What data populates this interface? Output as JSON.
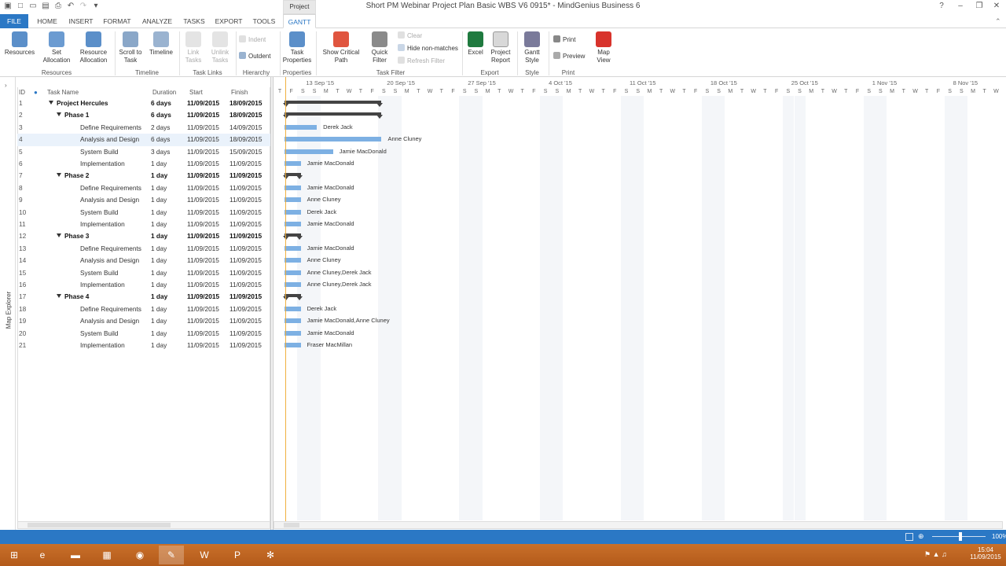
{
  "app": {
    "title": "Short PM Webinar Project Plan Basic WBS V6 0915* - MindGenius Business 6",
    "context_tab": "Project",
    "help": "?"
  },
  "tabs": [
    "FILE",
    "HOME",
    "INSERT",
    "FORMAT",
    "ANALYZE",
    "TASKS",
    "EXPORT",
    "TOOLS",
    "GANTT"
  ],
  "ribbon": {
    "resources": "Resources",
    "set_allocation": "Set Allocation",
    "resource_allocation": "Resource Allocation",
    "scroll_to_task": "Scroll to Task",
    "timeline": "Timeline",
    "link_tasks": "Link Tasks",
    "unlink_tasks": "Unlink Tasks",
    "indent": "Indent",
    "outdent": "Outdent",
    "task_properties": "Task Properties",
    "show_critical_path": "Show Critical Path",
    "quick_filter": "Quick Filter",
    "clear": "Clear",
    "hide_non_matches": "Hide non-matches",
    "refresh_filter": "Refresh Filter",
    "excel": "Excel",
    "project_report": "Project Report",
    "gantt_style": "Gantt Style",
    "print": "Print",
    "preview": "Preview",
    "map_view": "Map View",
    "groups": {
      "resources": "Resources",
      "timeline": "Timeline",
      "task_links": "Task Links",
      "hierarchy": "Hierarchy",
      "properties": "Properties",
      "task_filter": "Task Filter",
      "export": "Export",
      "style": "Style",
      "print": "Print"
    }
  },
  "map_explorer": "Map Explorer",
  "columns": {
    "id": "ID",
    "task": "Task Name",
    "duration": "Duration",
    "start": "Start",
    "finish": "Finish"
  },
  "rows": [
    {
      "id": "1",
      "name": "Project Hercules",
      "dur": "6 days",
      "start": "11/09/2015",
      "finish": "18/09/2015",
      "level": 0,
      "summary": true,
      "s": 0,
      "d": 6,
      "res": ""
    },
    {
      "id": "2",
      "name": "Phase 1",
      "dur": "6 days",
      "start": "11/09/2015",
      "finish": "18/09/2015",
      "level": 1,
      "summary": true,
      "s": 0,
      "d": 6,
      "res": ""
    },
    {
      "id": "3",
      "name": "Define Requirements",
      "dur": "2 days",
      "start": "11/09/2015",
      "finish": "14/09/2015",
      "level": 2,
      "summary": false,
      "s": 0,
      "d": 2,
      "res": "Derek Jack"
    },
    {
      "id": "4",
      "name": "Analysis and Design",
      "dur": "6 days",
      "start": "11/09/2015",
      "finish": "18/09/2015",
      "level": 2,
      "summary": false,
      "s": 0,
      "d": 6,
      "res": "Anne Cluney"
    },
    {
      "id": "5",
      "name": "System Build",
      "dur": "3 days",
      "start": "11/09/2015",
      "finish": "15/09/2015",
      "level": 2,
      "summary": false,
      "s": 0,
      "d": 3,
      "res": "Jamie MacDonald"
    },
    {
      "id": "6",
      "name": "Implementation",
      "dur": "1 day",
      "start": "11/09/2015",
      "finish": "11/09/2015",
      "level": 2,
      "summary": false,
      "s": 0,
      "d": 1,
      "res": "Jamie MacDonald"
    },
    {
      "id": "7",
      "name": "Phase 2",
      "dur": "1 day",
      "start": "11/09/2015",
      "finish": "11/09/2015",
      "level": 1,
      "summary": true,
      "s": 0,
      "d": 1,
      "res": ""
    },
    {
      "id": "8",
      "name": "Define Requirements",
      "dur": "1 day",
      "start": "11/09/2015",
      "finish": "11/09/2015",
      "level": 2,
      "summary": false,
      "s": 0,
      "d": 1,
      "res": "Jamie MacDonald"
    },
    {
      "id": "9",
      "name": "Analysis and Design",
      "dur": "1 day",
      "start": "11/09/2015",
      "finish": "11/09/2015",
      "level": 2,
      "summary": false,
      "s": 0,
      "d": 1,
      "res": "Anne Cluney"
    },
    {
      "id": "10",
      "name": "System Build",
      "dur": "1 day",
      "start": "11/09/2015",
      "finish": "11/09/2015",
      "level": 2,
      "summary": false,
      "s": 0,
      "d": 1,
      "res": "Derek Jack"
    },
    {
      "id": "11",
      "name": "Implementation",
      "dur": "1 day",
      "start": "11/09/2015",
      "finish": "11/09/2015",
      "level": 2,
      "summary": false,
      "s": 0,
      "d": 1,
      "res": "Jamie MacDonald"
    },
    {
      "id": "12",
      "name": "Phase 3",
      "dur": "1 day",
      "start": "11/09/2015",
      "finish": "11/09/2015",
      "level": 1,
      "summary": true,
      "s": 0,
      "d": 1,
      "res": ""
    },
    {
      "id": "13",
      "name": "Define Requirements",
      "dur": "1 day",
      "start": "11/09/2015",
      "finish": "11/09/2015",
      "level": 2,
      "summary": false,
      "s": 0,
      "d": 1,
      "res": "Jamie MacDonald"
    },
    {
      "id": "14",
      "name": "Analysis and Design",
      "dur": "1 day",
      "start": "11/09/2015",
      "finish": "11/09/2015",
      "level": 2,
      "summary": false,
      "s": 0,
      "d": 1,
      "res": "Anne Cluney"
    },
    {
      "id": "15",
      "name": "System Build",
      "dur": "1 day",
      "start": "11/09/2015",
      "finish": "11/09/2015",
      "level": 2,
      "summary": false,
      "s": 0,
      "d": 1,
      "res": "Anne Cluney,Derek Jack"
    },
    {
      "id": "16",
      "name": "Implementation",
      "dur": "1 day",
      "start": "11/09/2015",
      "finish": "11/09/2015",
      "level": 2,
      "summary": false,
      "s": 0,
      "d": 1,
      "res": "Anne Cluney,Derek Jack"
    },
    {
      "id": "17",
      "name": "Phase 4",
      "dur": "1 day",
      "start": "11/09/2015",
      "finish": "11/09/2015",
      "level": 1,
      "summary": true,
      "s": 0,
      "d": 1,
      "res": ""
    },
    {
      "id": "18",
      "name": "Define Requirements",
      "dur": "1 day",
      "start": "11/09/2015",
      "finish": "11/09/2015",
      "level": 2,
      "summary": false,
      "s": 0,
      "d": 1,
      "res": "Derek Jack"
    },
    {
      "id": "19",
      "name": "Analysis and Design",
      "dur": "1 day",
      "start": "11/09/2015",
      "finish": "11/09/2015",
      "level": 2,
      "summary": false,
      "s": 0,
      "d": 1,
      "res": "Jamie MacDonald,Anne Cluney"
    },
    {
      "id": "20",
      "name": "System Build",
      "dur": "1 day",
      "start": "11/09/2015",
      "finish": "11/09/2015",
      "level": 2,
      "summary": false,
      "s": 0,
      "d": 1,
      "res": "Jamie MacDonald"
    },
    {
      "id": "21",
      "name": "Implementation",
      "dur": "1 day",
      "start": "11/09/2015",
      "finish": "11/09/2015",
      "level": 2,
      "summary": false,
      "s": 0,
      "d": 1,
      "res": "Fraser MacMillan"
    }
  ],
  "timescale": {
    "weeks": [
      "13 Sep '15",
      "20 Sep '15",
      "27 Sep '15",
      "4 Oct '15",
      "11 Oct '15",
      "18 Oct '15",
      "25 Oct '15",
      "1 Nov '15",
      "8 Nov '15"
    ],
    "first_day_letters": [
      "T",
      "F",
      "S"
    ],
    "day_letters": [
      "S",
      "M",
      "T",
      "W",
      "T",
      "F",
      "S"
    ]
  },
  "status": {
    "zoom": "100%"
  },
  "taskbar": {
    "time": "15:04",
    "date": "11/09/2015"
  },
  "colors": {
    "accent": "#2b78c5",
    "task_bar": "#7db0e3",
    "summary_bar": "#444444",
    "taskbar": "#c0661f"
  }
}
